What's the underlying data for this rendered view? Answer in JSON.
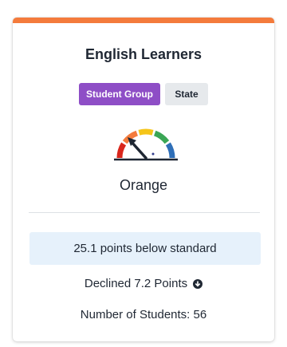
{
  "card": {
    "accent_color": "#f47b3c",
    "title": "English Learners",
    "tags": [
      {
        "label": "Student Group",
        "color": "#8e4ec6"
      },
      {
        "label": "State",
        "color": "#e6e9ec"
      }
    ],
    "gauge": {
      "icon": "performance-gauge-icon",
      "level": "Orange",
      "segment_colors": [
        "#d9261c",
        "#f47b3c",
        "#f5c518",
        "#3aa655",
        "#2f6fb8"
      ]
    },
    "rating_label": "Orange",
    "status_text": "25.1 points below standard",
    "change_text": "Declined 7.2 Points",
    "change_icon": "arrow-down-circle-icon",
    "students_text": "Number of Students: 56"
  }
}
